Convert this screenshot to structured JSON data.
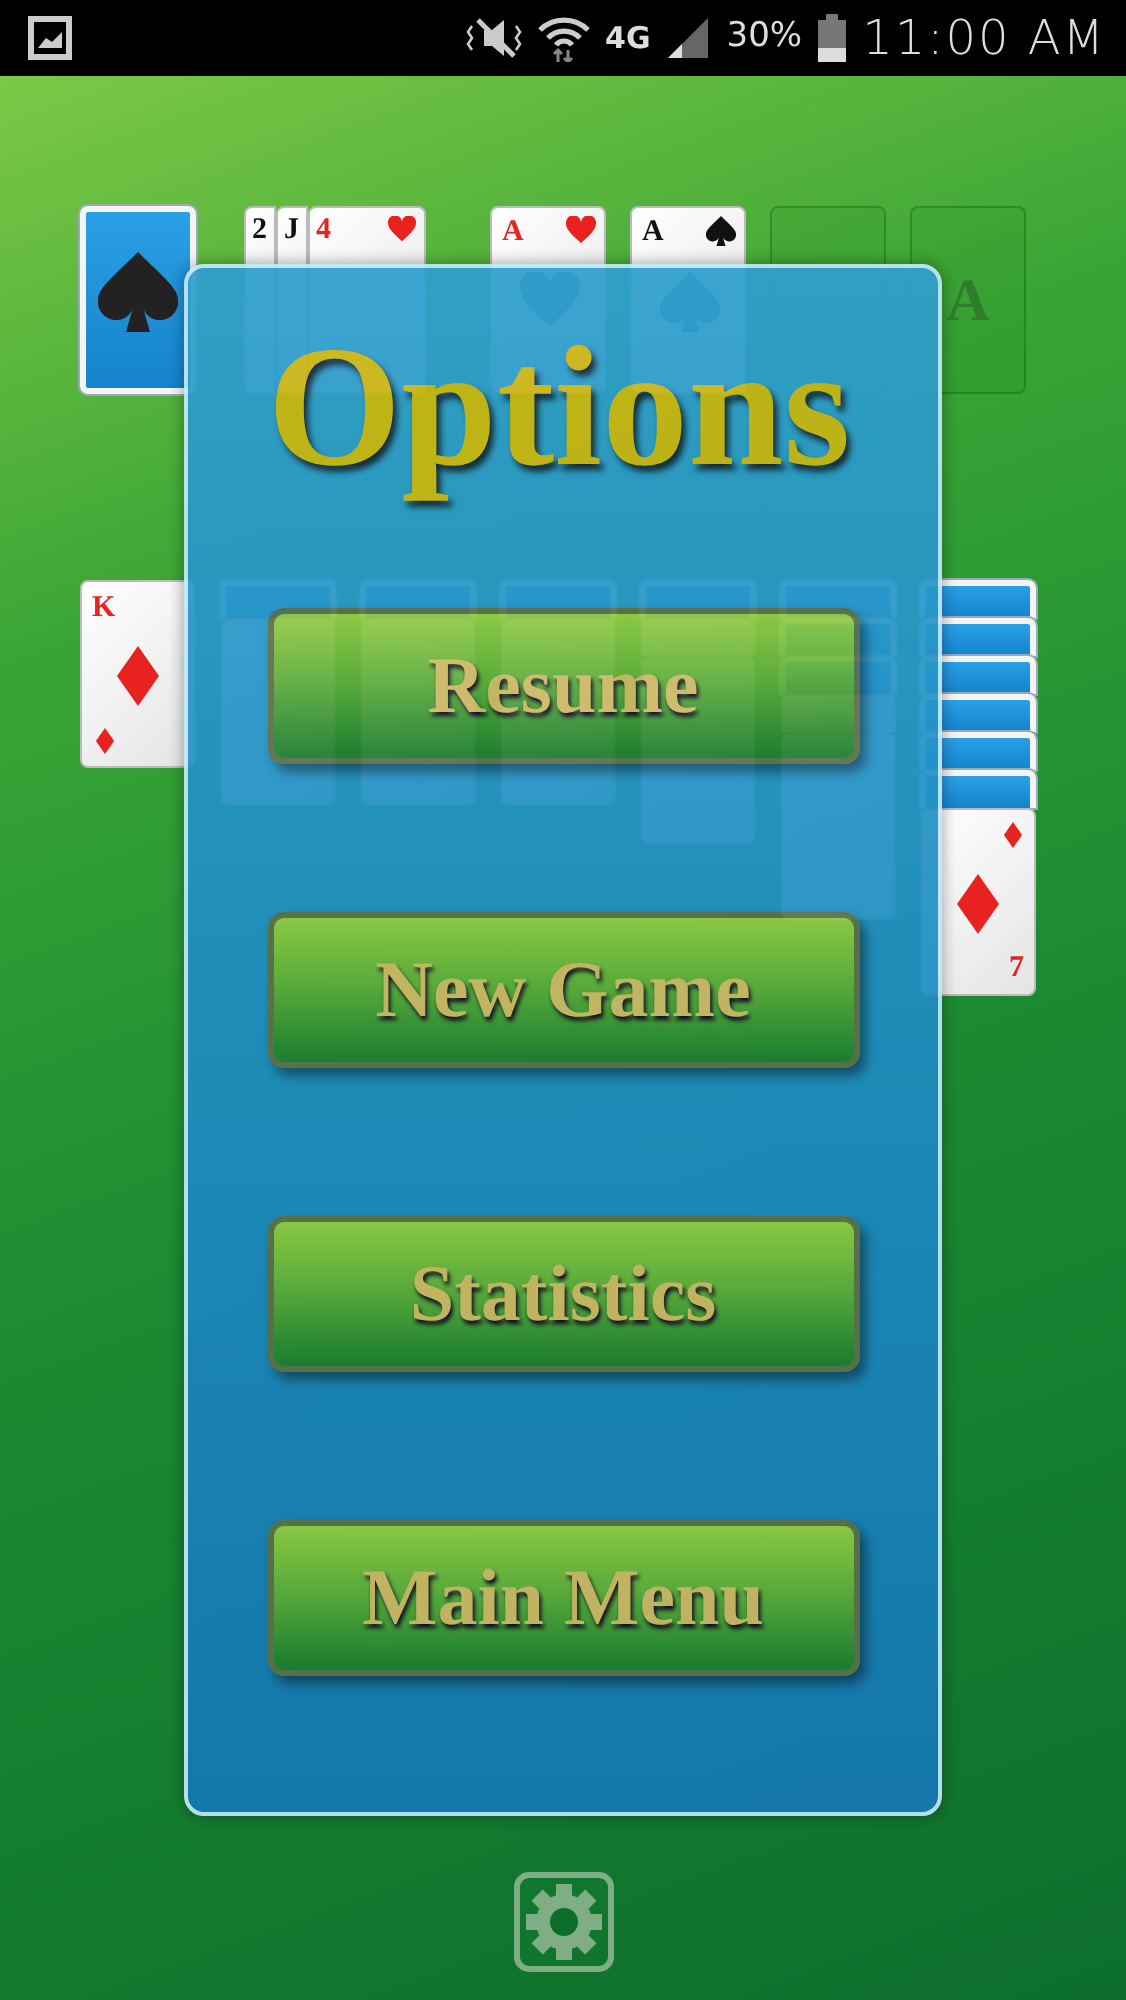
{
  "status_bar": {
    "network": "4G",
    "battery": "30%",
    "time": "11:00 AM"
  },
  "board": {
    "stock": {
      "face_up": false
    },
    "waste": [
      {
        "rank": "2",
        "red": false
      },
      {
        "rank": "J",
        "red": false
      },
      {
        "rank": "4",
        "red": true,
        "kind": "heart"
      }
    ],
    "foundations": [
      {
        "empty": false,
        "rank": "A",
        "kind": "heart",
        "red": true
      },
      {
        "empty": false,
        "rank": "A",
        "kind": "spade",
        "red": false
      },
      {
        "empty": true
      },
      {
        "empty": true,
        "placeholder": "A"
      }
    ],
    "tableau": [
      [
        {
          "face_up": true,
          "rank": "K",
          "kind": "diamond",
          "red": true,
          "rank_at_bottom": false
        }
      ],
      [
        {
          "face_up": false
        },
        {
          "face_up": true
        }
      ],
      [
        {
          "face_up": false
        },
        {
          "face_up": true
        }
      ],
      [
        {
          "face_up": false
        },
        {
          "face_up": true
        }
      ],
      [
        {
          "face_up": false
        },
        {
          "face_up": true
        },
        {
          "face_up": true
        }
      ],
      [
        {
          "face_up": false
        },
        {
          "face_up": false
        },
        {
          "face_up": false
        },
        {
          "face_up": true
        },
        {
          "face_up": true
        }
      ],
      [
        {
          "face_up": false
        },
        {
          "face_up": false
        },
        {
          "face_up": false
        },
        {
          "face_up": false
        },
        {
          "face_up": false
        },
        {
          "face_up": false
        },
        {
          "face_up": true,
          "rank": "7",
          "kind": "diamond",
          "red": true,
          "rank_at_bottom": true
        }
      ]
    ]
  },
  "options": {
    "title": "Options",
    "buttons": [
      "Resume",
      "New Game",
      "Statistics",
      "Main Menu"
    ]
  }
}
